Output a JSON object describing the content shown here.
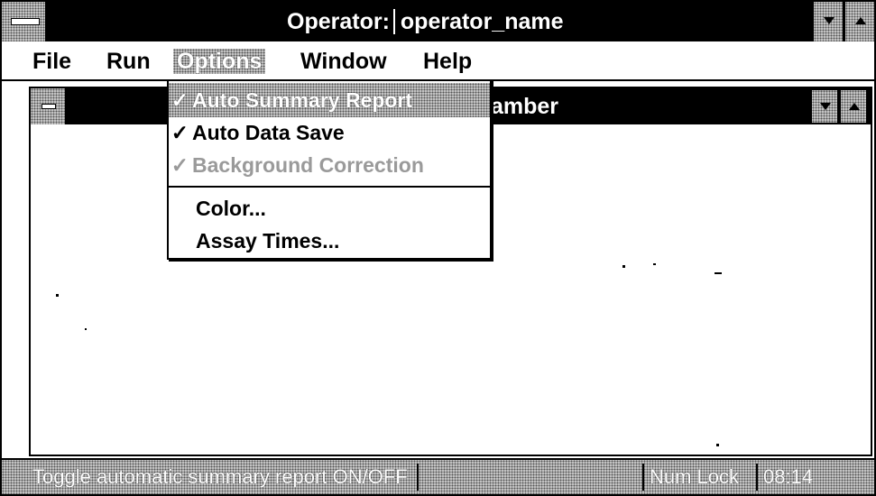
{
  "window": {
    "title_label": "Operator:",
    "title_value": "operator_name"
  },
  "menubar": {
    "items": [
      {
        "label": "File"
      },
      {
        "label": "Run"
      },
      {
        "label": "Options"
      },
      {
        "label": "Window"
      },
      {
        "label": "Help"
      }
    ]
  },
  "child_window": {
    "title_fragment": "amber"
  },
  "options_menu": {
    "items": [
      {
        "label": "Auto Summary Report",
        "checked": true,
        "state": "highlighted",
        "check_glyph": "✓"
      },
      {
        "label": "Auto Data Save",
        "checked": true,
        "state": "normal",
        "check_glyph": "✓"
      },
      {
        "label": "Background Correction",
        "checked": true,
        "state": "disabled",
        "check_glyph": "✓"
      },
      {
        "label": "Color...",
        "checked": false,
        "state": "normal"
      },
      {
        "label": "Assay Times...",
        "checked": false,
        "state": "normal"
      }
    ]
  },
  "statusbar": {
    "message": "Toggle automatic summary report ON/OFF",
    "numlock": "Num Lock",
    "time": "08:14"
  },
  "colors": {
    "titlebar": "#000000",
    "dither_light": "#c8c8c8",
    "dither_dark": "#555555",
    "disabled_text": "#9a9a9a"
  }
}
